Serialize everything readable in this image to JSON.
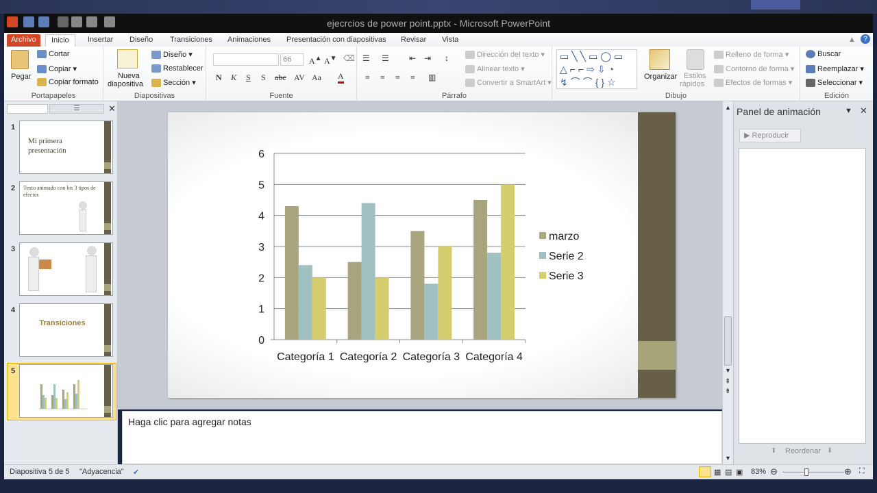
{
  "window": {
    "title": "ejecrcios de power point.pptx - Microsoft PowerPoint"
  },
  "tabs": [
    {
      "label": "Archivo"
    },
    {
      "label": "Inicio"
    },
    {
      "label": "Insertar"
    },
    {
      "label": "Diseño"
    },
    {
      "label": "Transiciones"
    },
    {
      "label": "Animaciones"
    },
    {
      "label": "Presentación con diapositivas"
    },
    {
      "label": "Revisar"
    },
    {
      "label": "Vista"
    }
  ],
  "ribbon": {
    "portapapeles": {
      "paste": "Pegar",
      "cut": "Cortar",
      "copy": "Copiar",
      "format_painter": "Copiar formato",
      "label": "Portapapeles"
    },
    "diapositivas": {
      "new_slide_1": "Nueva",
      "new_slide_2": "diapositiva",
      "layout": "Diseño",
      "reset": "Restablecer",
      "section": "Sección",
      "label": "Diapositivas"
    },
    "fuente": {
      "size": "66",
      "label": "Fuente"
    },
    "parrafo": {
      "text_direction": "Dirección del texto",
      "align_text": "Alinear texto",
      "smartart": "Convertir a SmartArt",
      "label": "Párrafo"
    },
    "dibujo": {
      "arrange": "Organizar",
      "quick_styles_1": "Estilos",
      "quick_styles_2": "rápidos",
      "fill": "Relleno de forma",
      "outline": "Contorno de forma",
      "effects": "Efectos de formas",
      "label": "Dibujo"
    },
    "edicion": {
      "find": "Buscar",
      "replace": "Reemplazar",
      "select": "Seleccionar",
      "label": "Edición"
    }
  },
  "thumbnails": [
    {
      "num": "1",
      "text": "Mi primera presentación"
    },
    {
      "num": "2",
      "text": "Texto animado con los 3 tipos de efectos"
    },
    {
      "num": "3",
      "text": ""
    },
    {
      "num": "4",
      "text": "Transiciones"
    },
    {
      "num": "5",
      "text": ""
    }
  ],
  "chart_data": {
    "type": "bar",
    "categories": [
      "Categoría 1",
      "Categoría 2",
      "Categoría 3",
      "Categoría 4"
    ],
    "series": [
      {
        "name": "marzo",
        "values": [
          4.3,
          2.5,
          3.5,
          4.5
        ],
        "color": "#a8a47e"
      },
      {
        "name": "Serie 2",
        "values": [
          2.4,
          4.4,
          1.8,
          2.8
        ],
        "color": "#9fc1c2"
      },
      {
        "name": "Serie 3",
        "values": [
          2.0,
          2.0,
          3.0,
          5.0
        ],
        "color": "#d6ce6e"
      }
    ],
    "ylim": [
      0,
      6
    ],
    "yticks": [
      "0",
      "1",
      "2",
      "3",
      "4",
      "5",
      "6"
    ],
    "grid": true,
    "legend": "right"
  },
  "notes": {
    "placeholder": "Haga clic para agregar notas"
  },
  "animation_pane": {
    "title": "Panel de animación",
    "play": "Reproducir",
    "reorder": "Reordenar"
  },
  "status": {
    "slide": "Diapositiva 5 de 5",
    "theme": "\"Adyacencia\"",
    "zoom": "83%"
  }
}
